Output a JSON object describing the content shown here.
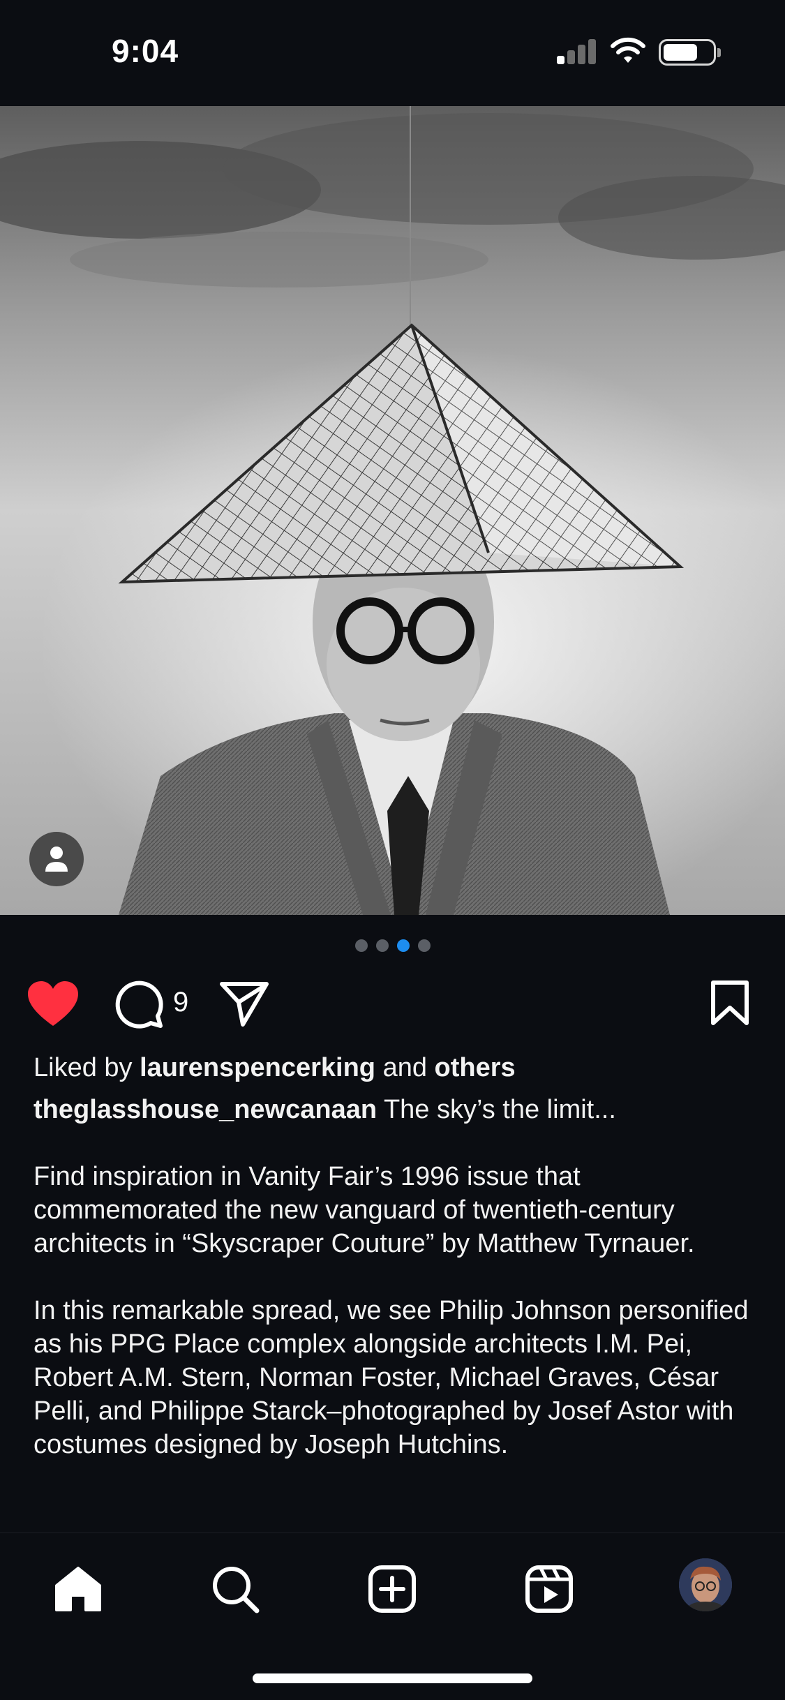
{
  "status_bar": {
    "time": "9:04",
    "signal_icon": "cellular-signal-icon",
    "wifi_icon": "wifi-icon",
    "battery_icon": "battery-icon",
    "battery_level": 0.8
  },
  "post": {
    "photo_alt_icon": "person-tag-icon",
    "carousel": {
      "count": 4,
      "active_index": 2
    },
    "actions": {
      "like_icon": "heart-filled-icon",
      "liked": true,
      "comment_icon": "comment-icon",
      "comment_count": "9",
      "share_icon": "paper-plane-icon",
      "save_icon": "bookmark-icon"
    },
    "likes": {
      "prefix": "Liked by",
      "user": "laurenspencerking",
      "joiner": "and",
      "others": "others"
    },
    "caption": {
      "username": "theglasshouse_newcanaan",
      "lead": "The sky’s the limit...",
      "paragraph_1": "Find inspiration in Vanity Fair’s 1996 issue that commemorated the new vanguard of twentieth-century architects in “Skyscraper Couture” by Matthew Tyrnauer.",
      "paragraph_2": "In this remarkable spread, we see Philip Johnson personified as his PPG Place complex alongside architects I.M. Pei, Robert A.M. Stern, Norman Foster, Michael Graves, César Pelli, and Philippe Starck–photographed by Josef Astor with costumes designed by Joseph Hutchins."
    }
  },
  "bottom_nav": {
    "items": [
      "home-icon",
      "search-icon",
      "create-post-icon",
      "reels-icon",
      "profile-avatar"
    ]
  },
  "colors": {
    "background": "#0b0d12",
    "like_red": "#ff3040",
    "active_dot": "#1d8df0",
    "inactive_dot": "#5b5f66"
  }
}
